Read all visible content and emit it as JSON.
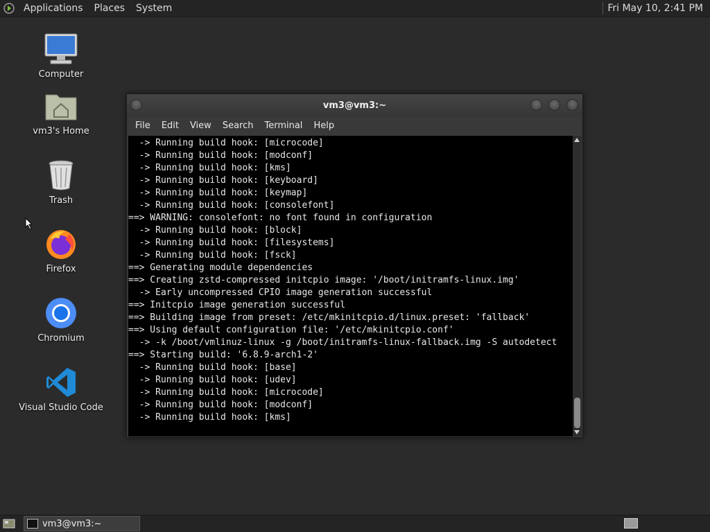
{
  "top_panel": {
    "menus": [
      "Applications",
      "Places",
      "System"
    ],
    "clock": "Fri May 10,  2:41 PM"
  },
  "desktop": {
    "icons": [
      {
        "label": "Computer",
        "icon": "computer-icon"
      },
      {
        "label": "vm3's Home",
        "icon": "home-folder-icon"
      },
      {
        "label": "Trash",
        "icon": "trash-icon"
      },
      {
        "label": "Firefox",
        "icon": "firefox-icon"
      },
      {
        "label": "Chromium",
        "icon": "chromium-icon"
      },
      {
        "label": "Visual Studio Code",
        "icon": "vscode-icon"
      }
    ]
  },
  "terminal": {
    "title": "vm3@vm3:~",
    "menu": [
      "File",
      "Edit",
      "View",
      "Search",
      "Terminal",
      "Help"
    ],
    "lines": [
      "  -> Running build hook: [microcode]",
      "  -> Running build hook: [modconf]",
      "  -> Running build hook: [kms]",
      "  -> Running build hook: [keyboard]",
      "  -> Running build hook: [keymap]",
      "  -> Running build hook: [consolefont]",
      "==> WARNING: consolefont: no font found in configuration",
      "  -> Running build hook: [block]",
      "  -> Running build hook: [filesystems]",
      "  -> Running build hook: [fsck]",
      "==> Generating module dependencies",
      "==> Creating zstd-compressed initcpio image: '/boot/initramfs-linux.img'",
      "  -> Early uncompressed CPIO image generation successful",
      "==> Initcpio image generation successful",
      "==> Building image from preset: /etc/mkinitcpio.d/linux.preset: 'fallback'",
      "==> Using default configuration file: '/etc/mkinitcpio.conf'",
      "  -> -k /boot/vmlinuz-linux -g /boot/initramfs-linux-fallback.img -S autodetect",
      "==> Starting build: '6.8.9-arch1-2'",
      "  -> Running build hook: [base]",
      "  -> Running build hook: [udev]",
      "  -> Running build hook: [microcode]",
      "  -> Running build hook: [modconf]",
      "  -> Running build hook: [kms]"
    ]
  },
  "taskbar": {
    "window_button": "vm3@vm3:~"
  }
}
